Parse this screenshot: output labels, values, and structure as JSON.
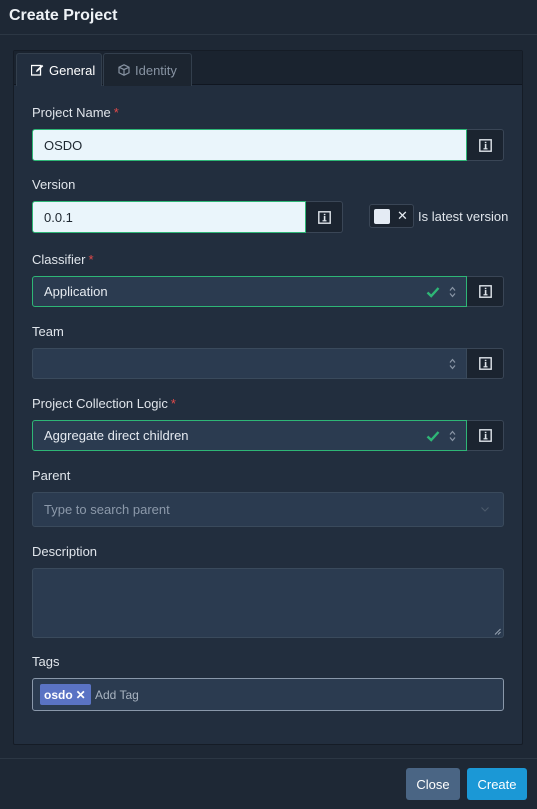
{
  "modal": {
    "title": "Create Project"
  },
  "tabs": [
    {
      "label": "General",
      "icon": "edit-icon",
      "active": true
    },
    {
      "label": "Identity",
      "icon": "cube-icon",
      "active": false
    }
  ],
  "form": {
    "project_name": {
      "label": "Project Name",
      "required_mark": "*",
      "value": "OSDO"
    },
    "version": {
      "label": "Version",
      "value": "0.0.1",
      "latest_label": "Is latest version",
      "latest_toggle_symbol": "✕"
    },
    "classifier": {
      "label": "Classifier",
      "required_mark": "*",
      "value": "Application"
    },
    "team": {
      "label": "Team",
      "value": ""
    },
    "collection_logic": {
      "label": "Project Collection Logic",
      "required_mark": "*",
      "value": "Aggregate direct children"
    },
    "parent": {
      "label": "Parent",
      "placeholder": "Type to search parent"
    },
    "description": {
      "label": "Description",
      "value": ""
    },
    "tags": {
      "label": "Tags",
      "items": [
        {
          "label": "osdo",
          "remove_symbol": "✕"
        }
      ],
      "placeholder": "Add Tag"
    }
  },
  "footer": {
    "close_label": "Close",
    "create_label": "Create"
  },
  "colors": {
    "valid": "#2eb676",
    "required": "#e24a4a",
    "primary": "#1b98d6",
    "secondary": "#4a6584",
    "tag": "#5a73c4"
  }
}
